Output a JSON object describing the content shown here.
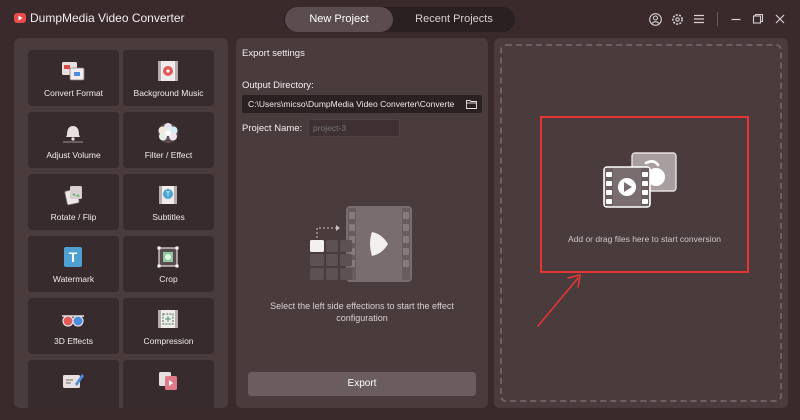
{
  "app": {
    "title": "DumpMedia Video Converter"
  },
  "tabs": [
    {
      "label": "New Project",
      "active": true
    },
    {
      "label": "Recent Projects",
      "active": false
    }
  ],
  "window_icons": [
    "account-icon",
    "settings-icon",
    "menu-icon",
    "minimize-icon",
    "maximize-icon",
    "close-icon"
  ],
  "tools": [
    {
      "label": "Convert Format",
      "icon": "convert-format-icon"
    },
    {
      "label": "Background Music",
      "icon": "background-music-icon"
    },
    {
      "label": "Adjust Volume",
      "icon": "adjust-volume-icon"
    },
    {
      "label": "Filter / Effect",
      "icon": "filter-effect-icon"
    },
    {
      "label": "Rotate / Flip",
      "icon": "rotate-flip-icon"
    },
    {
      "label": "Subtitles",
      "icon": "subtitles-icon"
    },
    {
      "label": "Watermark",
      "icon": "watermark-icon"
    },
    {
      "label": "Crop",
      "icon": "crop-icon"
    },
    {
      "label": "3D Effects",
      "icon": "3d-glasses-icon"
    },
    {
      "label": "Compression",
      "icon": "compression-icon"
    },
    {
      "label": "",
      "icon": "edit-icon"
    },
    {
      "label": "",
      "icon": "merge-icon"
    }
  ],
  "export_settings": {
    "title": "Export settings",
    "output_label": "Output Directory:",
    "output_value": "C:\\Users\\micso\\DumpMedia Video Converter\\Converte",
    "project_label": "Project Name:",
    "project_placeholder": "project-3",
    "hint": "Select the left side effections to start the effect configuration",
    "export_button": "Export"
  },
  "dropzone": {
    "hint": "Add or drag files here to start conversion"
  },
  "colors": {
    "accent_red": "#e53535",
    "background": "#3a2a2c",
    "panel": "#4a3b3d"
  }
}
